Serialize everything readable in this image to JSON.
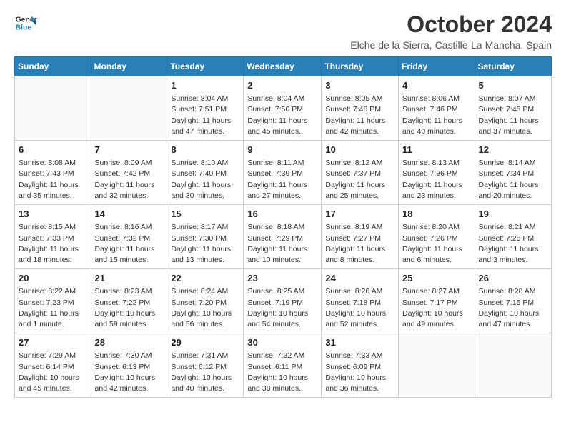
{
  "header": {
    "logo_line1": "General",
    "logo_line2": "Blue",
    "month": "October 2024",
    "location": "Elche de la Sierra, Castille-La Mancha, Spain"
  },
  "weekdays": [
    "Sunday",
    "Monday",
    "Tuesday",
    "Wednesday",
    "Thursday",
    "Friday",
    "Saturday"
  ],
  "weeks": [
    [
      {
        "day": "",
        "detail": ""
      },
      {
        "day": "",
        "detail": ""
      },
      {
        "day": "1",
        "detail": "Sunrise: 8:04 AM\nSunset: 7:51 PM\nDaylight: 11 hours and 47 minutes."
      },
      {
        "day": "2",
        "detail": "Sunrise: 8:04 AM\nSunset: 7:50 PM\nDaylight: 11 hours and 45 minutes."
      },
      {
        "day": "3",
        "detail": "Sunrise: 8:05 AM\nSunset: 7:48 PM\nDaylight: 11 hours and 42 minutes."
      },
      {
        "day": "4",
        "detail": "Sunrise: 8:06 AM\nSunset: 7:46 PM\nDaylight: 11 hours and 40 minutes."
      },
      {
        "day": "5",
        "detail": "Sunrise: 8:07 AM\nSunset: 7:45 PM\nDaylight: 11 hours and 37 minutes."
      }
    ],
    [
      {
        "day": "6",
        "detail": "Sunrise: 8:08 AM\nSunset: 7:43 PM\nDaylight: 11 hours and 35 minutes."
      },
      {
        "day": "7",
        "detail": "Sunrise: 8:09 AM\nSunset: 7:42 PM\nDaylight: 11 hours and 32 minutes."
      },
      {
        "day": "8",
        "detail": "Sunrise: 8:10 AM\nSunset: 7:40 PM\nDaylight: 11 hours and 30 minutes."
      },
      {
        "day": "9",
        "detail": "Sunrise: 8:11 AM\nSunset: 7:39 PM\nDaylight: 11 hours and 27 minutes."
      },
      {
        "day": "10",
        "detail": "Sunrise: 8:12 AM\nSunset: 7:37 PM\nDaylight: 11 hours and 25 minutes."
      },
      {
        "day": "11",
        "detail": "Sunrise: 8:13 AM\nSunset: 7:36 PM\nDaylight: 11 hours and 23 minutes."
      },
      {
        "day": "12",
        "detail": "Sunrise: 8:14 AM\nSunset: 7:34 PM\nDaylight: 11 hours and 20 minutes."
      }
    ],
    [
      {
        "day": "13",
        "detail": "Sunrise: 8:15 AM\nSunset: 7:33 PM\nDaylight: 11 hours and 18 minutes."
      },
      {
        "day": "14",
        "detail": "Sunrise: 8:16 AM\nSunset: 7:32 PM\nDaylight: 11 hours and 15 minutes."
      },
      {
        "day": "15",
        "detail": "Sunrise: 8:17 AM\nSunset: 7:30 PM\nDaylight: 11 hours and 13 minutes."
      },
      {
        "day": "16",
        "detail": "Sunrise: 8:18 AM\nSunset: 7:29 PM\nDaylight: 11 hours and 10 minutes."
      },
      {
        "day": "17",
        "detail": "Sunrise: 8:19 AM\nSunset: 7:27 PM\nDaylight: 11 hours and 8 minutes."
      },
      {
        "day": "18",
        "detail": "Sunrise: 8:20 AM\nSunset: 7:26 PM\nDaylight: 11 hours and 6 minutes."
      },
      {
        "day": "19",
        "detail": "Sunrise: 8:21 AM\nSunset: 7:25 PM\nDaylight: 11 hours and 3 minutes."
      }
    ],
    [
      {
        "day": "20",
        "detail": "Sunrise: 8:22 AM\nSunset: 7:23 PM\nDaylight: 11 hours and 1 minute."
      },
      {
        "day": "21",
        "detail": "Sunrise: 8:23 AM\nSunset: 7:22 PM\nDaylight: 10 hours and 59 minutes."
      },
      {
        "day": "22",
        "detail": "Sunrise: 8:24 AM\nSunset: 7:20 PM\nDaylight: 10 hours and 56 minutes."
      },
      {
        "day": "23",
        "detail": "Sunrise: 8:25 AM\nSunset: 7:19 PM\nDaylight: 10 hours and 54 minutes."
      },
      {
        "day": "24",
        "detail": "Sunrise: 8:26 AM\nSunset: 7:18 PM\nDaylight: 10 hours and 52 minutes."
      },
      {
        "day": "25",
        "detail": "Sunrise: 8:27 AM\nSunset: 7:17 PM\nDaylight: 10 hours and 49 minutes."
      },
      {
        "day": "26",
        "detail": "Sunrise: 8:28 AM\nSunset: 7:15 PM\nDaylight: 10 hours and 47 minutes."
      }
    ],
    [
      {
        "day": "27",
        "detail": "Sunrise: 7:29 AM\nSunset: 6:14 PM\nDaylight: 10 hours and 45 minutes."
      },
      {
        "day": "28",
        "detail": "Sunrise: 7:30 AM\nSunset: 6:13 PM\nDaylight: 10 hours and 42 minutes."
      },
      {
        "day": "29",
        "detail": "Sunrise: 7:31 AM\nSunset: 6:12 PM\nDaylight: 10 hours and 40 minutes."
      },
      {
        "day": "30",
        "detail": "Sunrise: 7:32 AM\nSunset: 6:11 PM\nDaylight: 10 hours and 38 minutes."
      },
      {
        "day": "31",
        "detail": "Sunrise: 7:33 AM\nSunset: 6:09 PM\nDaylight: 10 hours and 36 minutes."
      },
      {
        "day": "",
        "detail": ""
      },
      {
        "day": "",
        "detail": ""
      }
    ]
  ]
}
